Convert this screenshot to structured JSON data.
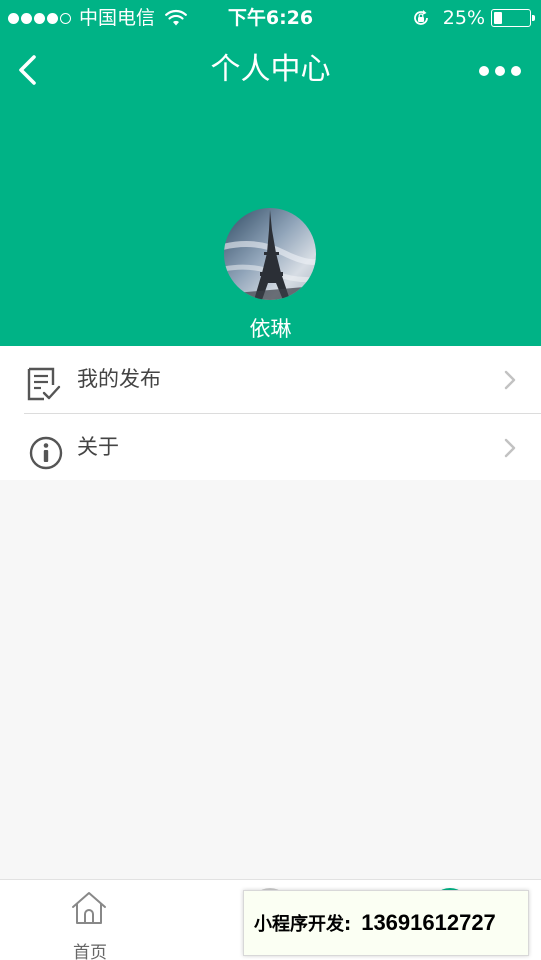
{
  "status_bar": {
    "carrier": "中国电信",
    "time": "下午6:26",
    "battery_percent": "25%",
    "battery_level": 0.25,
    "signal_bars": 4
  },
  "header": {
    "title": "个人中心",
    "back_icon": "chevron-left-icon",
    "more_icon": "more-dots-icon",
    "avatar_image": "eiffel-tower-photo",
    "username": "依琳"
  },
  "menu": {
    "items": [
      {
        "label": "我的发布",
        "icon": "document-check-icon"
      },
      {
        "label": "关于",
        "icon": "info-icon"
      }
    ]
  },
  "tabbar": {
    "tabs": [
      {
        "label": "首页",
        "icon": "home-icon"
      }
    ]
  },
  "watermark": {
    "label": "小程序开发:",
    "phone": "13691612727"
  },
  "colors": {
    "brand_green": "#00b386",
    "background": "#f7f7f7"
  }
}
